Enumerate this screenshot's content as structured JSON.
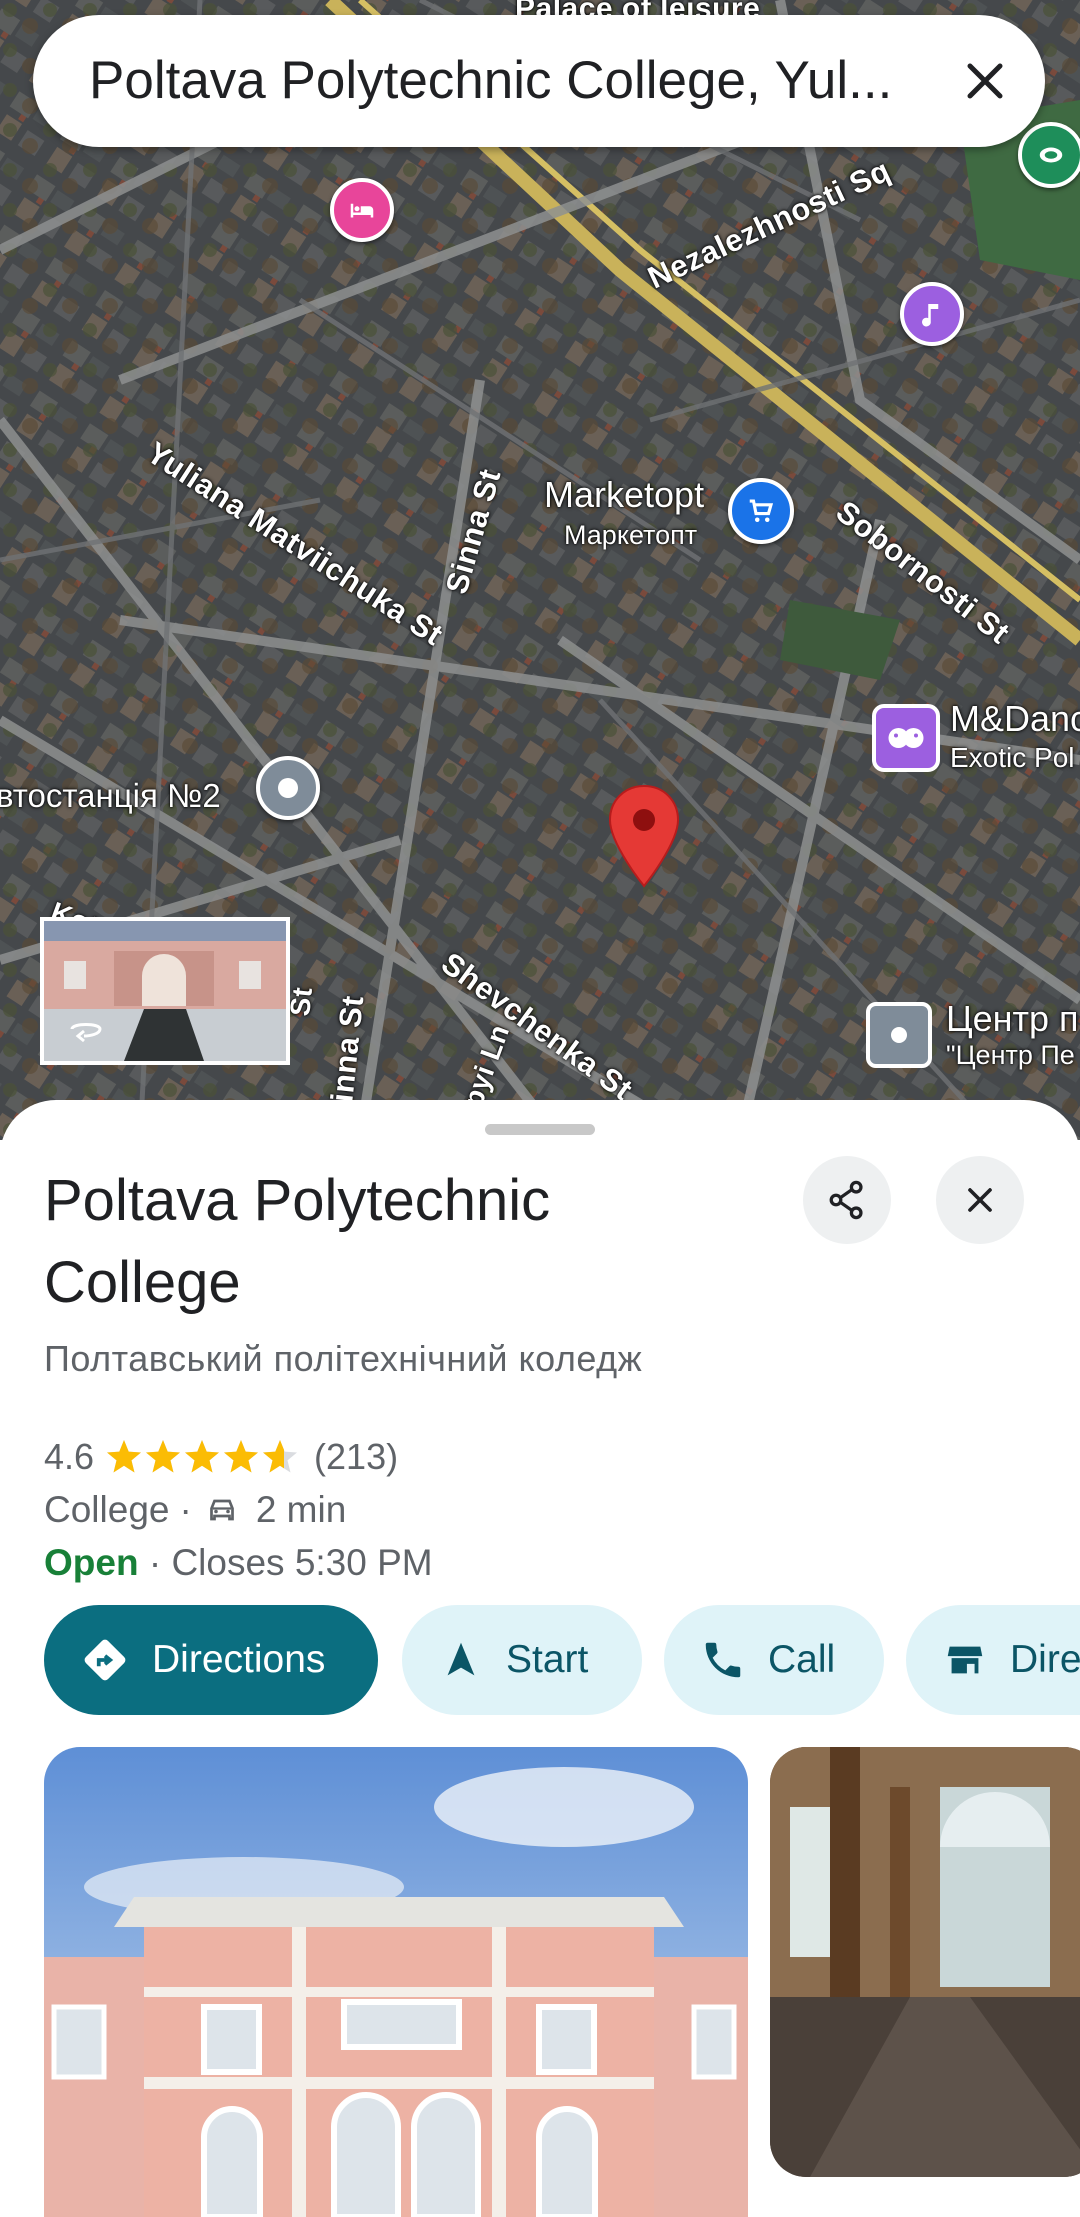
{
  "search": {
    "query": "Poltava Polytechnic College, Yul..."
  },
  "map": {
    "labels": {
      "palace": "Palace of leisure",
      "nezalezhnosti": "Nezalezhnosti Sq",
      "yuliana": "Yuliana Matviichuka St",
      "sinna_top": "Sinna St",
      "sinna_bottom": "Sinna St",
      "marketopt": "Marketopt",
      "marketopt_local": "Маркетопт",
      "sobornosti": "Sobornosti St",
      "mdance": "M&Danc",
      "mdance_sub": "Exotic Pol",
      "avtostantsia": "втостанція №2",
      "kots": "Kots",
      "st_small": "St",
      "shevchenka": "Shevchenka St",
      "pyi": "pyi Ln",
      "tsentr": "Центр п",
      "tsentr_sub": "\"Центр Пе"
    }
  },
  "place": {
    "title": "Poltava Polytechnic College",
    "local_name": "Полтавський політехнічний коледж",
    "rating": "4.6",
    "review_count": "(213)",
    "stars": 4.6,
    "category": "College",
    "separator": "·",
    "drive_time": "2 min",
    "open_status": "Open",
    "hours": "· Closes 5:30 PM"
  },
  "actions": {
    "directions": "Directions",
    "start": "Start",
    "call": "Call",
    "directory": "Dire"
  },
  "colors": {
    "primary": "#0b6e80",
    "secondary_bg": "#dff3f8",
    "open_green": "#188038",
    "pin_red": "#e53935",
    "star": "#fbbc04"
  },
  "icons": {
    "search_clear": "close-icon",
    "share": "share-icon",
    "close": "close-icon",
    "directions": "directions-diamond-icon",
    "start": "navigation-arrow-icon",
    "call": "phone-icon",
    "directory": "storefront-icon",
    "car": "car-icon"
  }
}
